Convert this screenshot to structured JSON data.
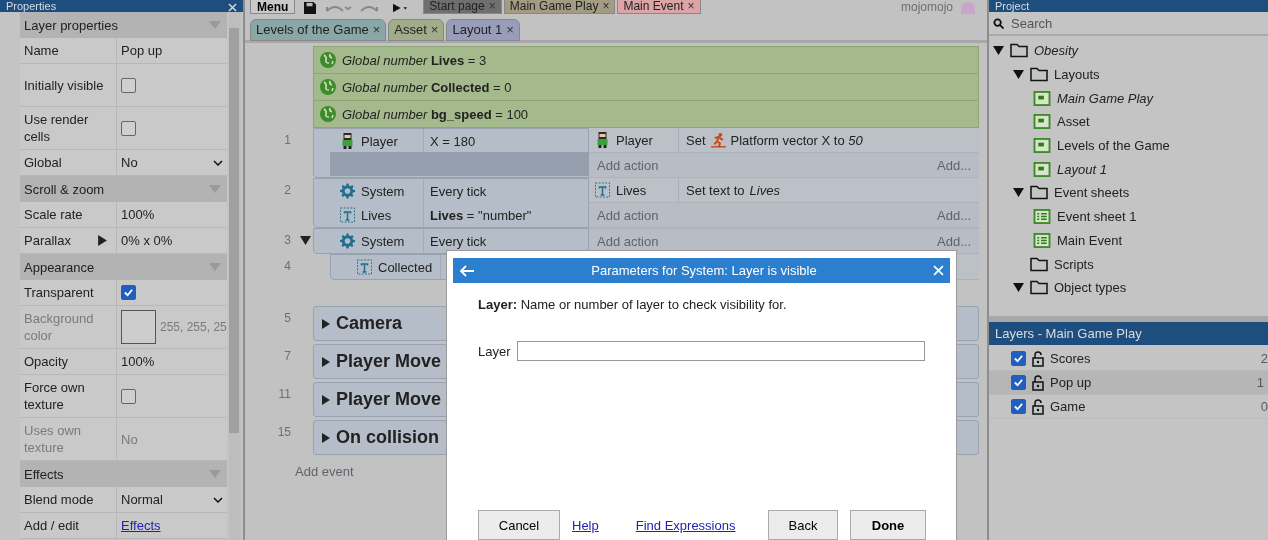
{
  "properties": {
    "title": "Properties",
    "sections": [
      {
        "title": "Layer properties",
        "rows": [
          {
            "label": "Name",
            "kind": "text",
            "value": "Pop up",
            "disabled": false
          },
          {
            "label": "Initially visible",
            "kind": "checkbox",
            "checked": false,
            "disabled": false
          },
          {
            "label": "Use render cells",
            "kind": "checkbox",
            "checked": false,
            "disabled": false
          },
          {
            "label": "Global",
            "kind": "select",
            "value": "No",
            "disabled": false
          }
        ]
      },
      {
        "title": "Scroll & zoom",
        "rows": [
          {
            "label": "Scale rate",
            "kind": "text",
            "value": "100%",
            "disabled": false
          },
          {
            "label": "Parallax",
            "kind": "expander",
            "value": "0% x 0%",
            "disabled": false
          }
        ]
      },
      {
        "title": "Appearance",
        "rows": [
          {
            "label": "Transparent",
            "kind": "checkbox",
            "checked": true,
            "disabled": false
          },
          {
            "label": "Background color",
            "kind": "color",
            "value": "255, 255, 25",
            "disabled": true
          },
          {
            "label": "Opacity",
            "kind": "text",
            "value": "100%",
            "disabled": false
          },
          {
            "label": "Force own texture",
            "kind": "checkbox",
            "checked": false,
            "disabled": false
          },
          {
            "label": "Uses own texture",
            "kind": "text",
            "value": "No",
            "disabled": true
          }
        ]
      },
      {
        "title": "Effects",
        "rows": [
          {
            "label": "Blend mode",
            "kind": "select",
            "value": "Normal",
            "disabled": false
          },
          {
            "label": "Add / edit",
            "kind": "link",
            "value": "Effects",
            "disabled": false
          }
        ]
      }
    ]
  },
  "toolbar": {
    "menu": "Menu",
    "user": "mojomojo"
  },
  "tabs": [
    {
      "label": "Start page",
      "close": "×",
      "color": "#6f6f6f"
    },
    {
      "label": "Main Game Play",
      "close": "×",
      "color": "#a39c82"
    },
    {
      "label": "Main Event",
      "close": "×",
      "color": "#dca4a6"
    }
  ],
  "subtabs": [
    {
      "label": "Levels of the Game",
      "close": "×",
      "color": "#8aa7a8"
    },
    {
      "label": "Asset",
      "close": "×",
      "color": "#a2ac8a"
    },
    {
      "label": "Layout 1",
      "close": "×",
      "color": "#9a9db9"
    }
  ],
  "globals": [
    "*Global number* **Lives** = 3",
    "*Global number* **Collected** = 0",
    "*Global number* **bg_speed** = 100"
  ],
  "events": [
    {
      "number": "1",
      "conditions": [
        {
          "object": "Player",
          "kind": "sprite",
          "text": "X = 180"
        }
      ],
      "actions": [
        {
          "object": "Player",
          "kind": "sprite",
          "verb": "Set",
          "behavior_icon": true,
          "text": "Platform vector X to *50*"
        }
      ],
      "add_action": "Add action",
      "add": "Add..."
    },
    {
      "number": "2",
      "conditions": [
        {
          "object": "System",
          "kind": "system",
          "text": "Every tick"
        },
        {
          "object": "Lives",
          "kind": "text",
          "text": "**Lives** = \"number\""
        }
      ],
      "actions": [
        {
          "object": "Lives",
          "kind": "text",
          "verb": "Set text to",
          "behavior_icon": false,
          "text": "*Lives*"
        }
      ],
      "add_action": "Add action",
      "add": "Add..."
    },
    {
      "number": "3",
      "expanded": true,
      "conditions": [
        {
          "object": "System",
          "kind": "system",
          "text": "Every tick"
        }
      ],
      "add_action": "Add action",
      "add": "Add...",
      "children": [
        {
          "number": "4",
          "conditions": [
            {
              "object": "Collected",
              "kind": "text"
            }
          ]
        }
      ]
    }
  ],
  "groups": [
    {
      "number": "5",
      "title": "Camera"
    },
    {
      "number": "7",
      "title": "Player Move"
    },
    {
      "number": "11",
      "title": "Player Move"
    },
    {
      "number": "15",
      "title": "On collision"
    }
  ],
  "add_event": "Add event",
  "project": {
    "title": "Project",
    "search": {
      "placeholder": "Search"
    },
    "tree": [
      {
        "label": "Obesity",
        "kind": "folder",
        "expanded": true,
        "emphasized": true,
        "children": [
          {
            "label": "Layouts",
            "kind": "folder",
            "expanded": true,
            "emphasized": false,
            "children": [
              {
                "label": "Main Game Play",
                "kind": "layout",
                "emphasized": true
              },
              {
                "label": "Asset",
                "kind": "layout",
                "emphasized": false
              },
              {
                "label": "Levels of the Game",
                "kind": "layout",
                "emphasized": false
              },
              {
                "label": "Layout 1",
                "kind": "layout",
                "emphasized": true
              }
            ]
          },
          {
            "label": "Event sheets",
            "kind": "folder",
            "expanded": true,
            "emphasized": false,
            "children": [
              {
                "label": "Event sheet 1",
                "kind": "sheet",
                "emphasized": false
              },
              {
                "label": "Main Event",
                "kind": "sheet",
                "emphasized": false
              }
            ]
          },
          {
            "label": "Scripts",
            "kind": "folder",
            "expanded": false,
            "emphasized": false
          },
          {
            "label": "Object types",
            "kind": "folder",
            "expanded": true,
            "emphasized": false
          }
        ]
      }
    ]
  },
  "layers": {
    "title": "Layers - Main Game Play",
    "items": [
      {
        "name": "Scores",
        "visible": true,
        "index": "2",
        "selected": false
      },
      {
        "name": "Pop up",
        "visible": true,
        "index": "1",
        "selected": true
      },
      {
        "name": "Game",
        "visible": true,
        "index": "0",
        "selected": false
      }
    ]
  },
  "dialog": {
    "title": "Parameters for System: Layer is visible",
    "description": "**Layer:** Name or number of layer to check visibility for.",
    "field_label": "Layer",
    "buttons": [
      {
        "label": "Cancel",
        "kind": "button"
      },
      {
        "label": "Help",
        "kind": "link"
      },
      {
        "label": "Find Expressions",
        "kind": "link"
      },
      {
        "label": "Back",
        "kind": "button"
      },
      {
        "label": "Done",
        "kind": "default"
      }
    ]
  }
}
